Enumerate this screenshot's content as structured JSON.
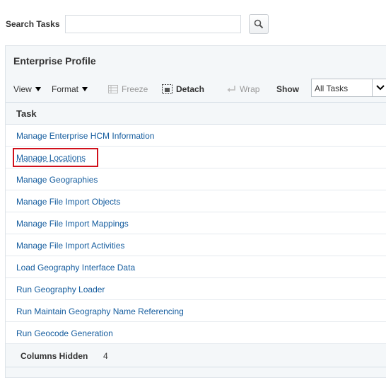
{
  "search": {
    "label": "Search Tasks",
    "value": "",
    "placeholder": ""
  },
  "panel": {
    "title": "Enterprise Profile"
  },
  "toolbar": {
    "view_label": "View",
    "format_label": "Format",
    "freeze_label": "Freeze",
    "detach_label": "Detach",
    "wrap_label": "Wrap",
    "show_label": "Show",
    "show_value": "All Tasks"
  },
  "table": {
    "header": "Task",
    "rows": [
      "Manage Enterprise HCM Information",
      "Manage Locations",
      "Manage Geographies",
      "Manage File Import Objects",
      "Manage File Import Mappings",
      "Manage File Import Activities",
      "Load Geography Interface Data",
      "Run Geography Loader",
      "Run Maintain Geography Name Referencing",
      "Run Geocode Generation"
    ],
    "columns_hidden_label": "Columns Hidden",
    "columns_hidden_count": "4"
  },
  "colors": {
    "link": "#145c9e",
    "highlight": "#d0101b",
    "panel_bg": "#f4f7f9"
  }
}
